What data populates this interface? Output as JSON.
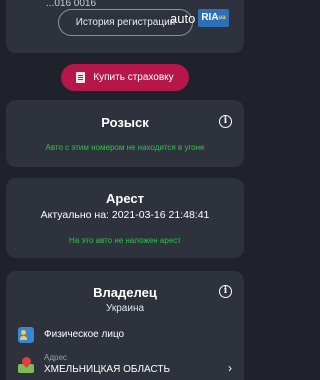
{
  "top_card": {
    "partial_text": "...016 0016",
    "history_button": "История регистрации"
  },
  "buy_insurance": {
    "label": "Купить страховку"
  },
  "search": {
    "title": "Розыск",
    "status": "Авто с этим номером не находится в угоне"
  },
  "arrest": {
    "title": "Арест",
    "actual_label": "Актуально на:",
    "actual_date": "2021-03-16 21:48:41",
    "status": "На это авто не наложен арест"
  },
  "owner": {
    "title": "Владелец",
    "country": "Украина",
    "person_type": "Физическое лицо",
    "address_label": "Адрес",
    "address_value": "ХМЕЛЬНИЦКАЯ ОБЛАСТЬ"
  },
  "watermark": {
    "left": "auto",
    "right": "RIA",
    "sup": "ua"
  },
  "icons": [
    "insurance-icon",
    "info-icon",
    "person-icon",
    "address-pin-icon",
    "chevron-right-icon"
  ],
  "colors": {
    "background": "#1f222b",
    "card": "#2e323c",
    "accent": "#b5174a",
    "status_green": "#2ec44a"
  }
}
